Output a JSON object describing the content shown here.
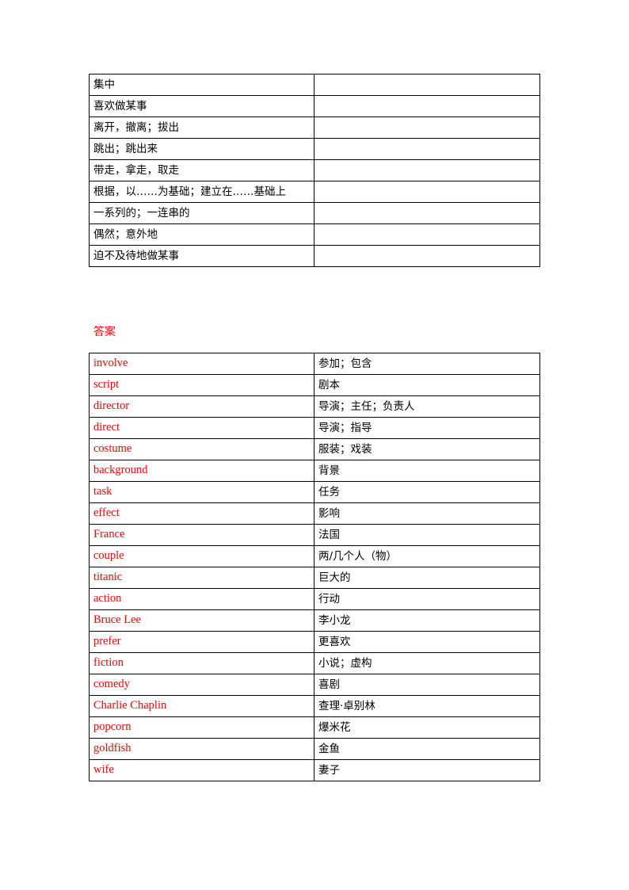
{
  "document": {
    "page_background": "#ffffff",
    "accent_color": "#ff0000",
    "border_color": "#000000"
  },
  "prompt_table": {
    "name": "chinese-prompts-table",
    "rows": [
      {
        "prompt": "集中",
        "answer": ""
      },
      {
        "prompt": "喜欢做某事",
        "answer": ""
      },
      {
        "prompt": "离开，撤离；拔出",
        "answer": ""
      },
      {
        "prompt": "跳出；跳出来",
        "answer": ""
      },
      {
        "prompt": "带走，拿走，取走",
        "answer": ""
      },
      {
        "prompt": "根据，以……为基础；建立在……基础上",
        "answer": ""
      },
      {
        "prompt": "一系列的；一连串的",
        "answer": ""
      },
      {
        "prompt": "偶然；意外地",
        "answer": ""
      },
      {
        "prompt": "迫不及待地做某事",
        "answer": ""
      }
    ]
  },
  "answers_section": {
    "heading": "答案",
    "table": {
      "name": "answer-key-table",
      "rows": [
        {
          "word": "involve",
          "meaning": "参加；包含"
        },
        {
          "word": "script",
          "meaning": "剧本"
        },
        {
          "word": "director",
          "meaning": "导演；主任；负责人"
        },
        {
          "word": "direct",
          "meaning": "导演；指导"
        },
        {
          "word": "costume",
          "meaning": "服装；戏装"
        },
        {
          "word": "background",
          "meaning": "背景"
        },
        {
          "word": "task",
          "meaning": "任务"
        },
        {
          "word": "effect",
          "meaning": "影响"
        },
        {
          "word": "France",
          "meaning": "法国"
        },
        {
          "word": "couple",
          "meaning": "两/几个人（物）"
        },
        {
          "word": "titanic",
          "meaning": "巨大的"
        },
        {
          "word": "action",
          "meaning": "行动"
        },
        {
          "word": "Bruce Lee",
          "meaning": "李小龙"
        },
        {
          "word": "prefer",
          "meaning": "更喜欢"
        },
        {
          "word": "fiction",
          "meaning": "小说；虚构"
        },
        {
          "word": "comedy",
          "meaning": "喜剧"
        },
        {
          "word": "Charlie Chaplin",
          "meaning": "查理·卓别林"
        },
        {
          "word": "popcorn",
          "meaning": "爆米花"
        },
        {
          "word": "goldfish",
          "meaning": "金鱼"
        },
        {
          "word": "wife",
          "meaning": "妻子"
        }
      ]
    }
  }
}
